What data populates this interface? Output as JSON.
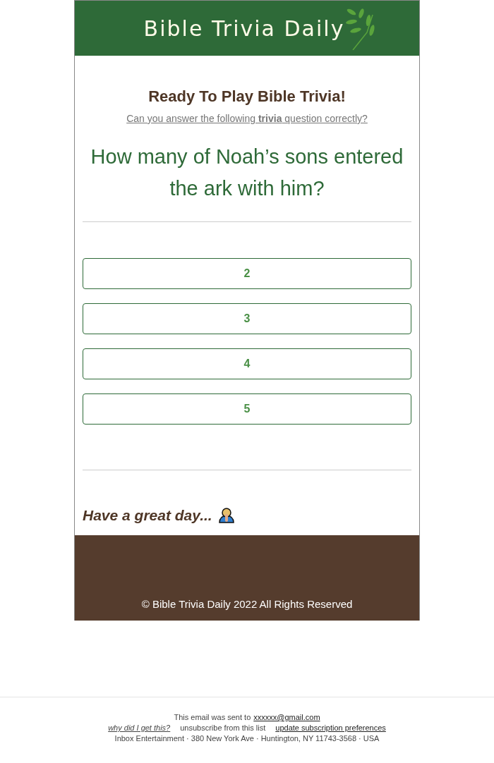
{
  "header": {
    "logo": "Bible Trivia Daily"
  },
  "intro": {
    "title": "Ready To Play Bible Trivia!",
    "subtitle": "Can you answer the following **trivia** question correctly?"
  },
  "question": "How many of Noah’s sons entered the ark with him?",
  "answers": [
    "2",
    "3",
    "4",
    "5"
  ],
  "closing": "Have a great day...",
  "footer": {
    "copyright": "© Bible Trivia Daily 2022 All Rights Reserved"
  },
  "email_footer": {
    "sent_to_text": "This email was sent to",
    "email": "xxxxxx@gmail.com",
    "why_link": "why did I get this?",
    "unsubscribe": "unsubscribe from this list",
    "preferences_link": "update subscription preferences",
    "address": "Inbox Entertainment · 380 New York Ave · Huntington, NY 11743-3568 · USA"
  }
}
